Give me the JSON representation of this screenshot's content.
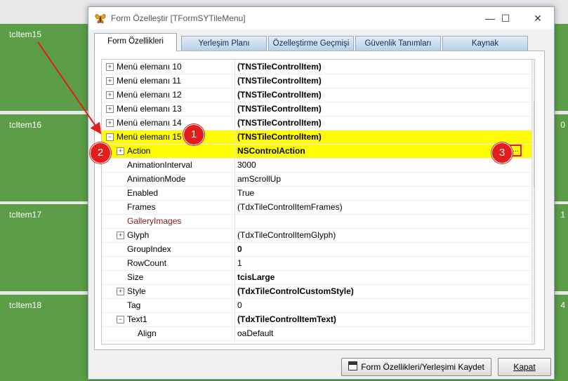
{
  "tiles": [
    {
      "label": "tcItem15",
      "right": ""
    },
    {
      "label": "tcItem16",
      "right": "0"
    },
    {
      "label": "tcItem17",
      "right": "1"
    },
    {
      "label": "tcItem18",
      "right": "4"
    }
  ],
  "window": {
    "title": "Form Özelleştir [TFormSYTileMenu]",
    "minimize": "—",
    "maximize": "☐",
    "close": "✕"
  },
  "tabs": [
    {
      "label": "Form Özellikleri",
      "active": true
    },
    {
      "label": "Yerleşim Planı",
      "active": false
    },
    {
      "label": "Özelleştirme Geçmişi",
      "active": false
    },
    {
      "label": "Güvenlik Tanımları",
      "active": false
    },
    {
      "label": "Kaynak",
      "active": false
    }
  ],
  "properties": [
    {
      "name": "Menü elemanı 10",
      "value": "(TNSTileControlItem)",
      "indent": 0,
      "expander": "+",
      "bold": true
    },
    {
      "name": "Menü elemanı 11",
      "value": "(TNSTileControlItem)",
      "indent": 0,
      "expander": "+",
      "bold": true
    },
    {
      "name": "Menü elemanı 12",
      "value": "(TNSTileControlItem)",
      "indent": 0,
      "expander": "+",
      "bold": true
    },
    {
      "name": "Menü elemanı 13",
      "value": "(TNSTileControlItem)",
      "indent": 0,
      "expander": "+",
      "bold": true
    },
    {
      "name": "Menü elemanı 14",
      "value": "(TNSTileControlItem)",
      "indent": 0,
      "expander": "+",
      "bold": true
    },
    {
      "name": "Menü elemanı 15",
      "value": "(TNSTileControlItem)",
      "indent": 0,
      "expander": "−",
      "bold": true,
      "highlight": true
    },
    {
      "name": "Action",
      "value": "NSControlAction",
      "indent": 1,
      "expander": "+",
      "bold": true,
      "highlight": true,
      "ellipsis": true
    },
    {
      "name": "AnimationInterval",
      "value": "3000",
      "indent": 1
    },
    {
      "name": "AnimationMode",
      "value": "amScrollUp",
      "indent": 1
    },
    {
      "name": "Enabled",
      "value": "True",
      "indent": 1
    },
    {
      "name": "Frames",
      "value": "(TdxTileControlItemFrames)",
      "indent": 1
    },
    {
      "name": "GalleryImages",
      "value": "",
      "indent": 1,
      "maroon": true
    },
    {
      "name": "Glyph",
      "value": "(TdxTileControlItemGlyph)",
      "indent": 1,
      "expander": "+"
    },
    {
      "name": "GroupIndex",
      "value": "0",
      "indent": 1,
      "bold": true
    },
    {
      "name": "RowCount",
      "value": "1",
      "indent": 1
    },
    {
      "name": "Size",
      "value": "tcisLarge",
      "indent": 1,
      "bold": true
    },
    {
      "name": "Style",
      "value": "(TdxTileControlCustomStyle)",
      "indent": 1,
      "expander": "+",
      "bold": true
    },
    {
      "name": "Tag",
      "value": "0",
      "indent": 1
    },
    {
      "name": "Text1",
      "value": "(TdxTileControlItemText)",
      "indent": 1,
      "expander": "−",
      "bold": true
    },
    {
      "name": "Align",
      "value": "oaDefault",
      "indent": 2
    }
  ],
  "ellipsis_label": "···",
  "buttons": {
    "save": "Form Özellikleri/Yerleşimi Kaydet",
    "close": "Kapat"
  },
  "badges": [
    "1",
    "2",
    "3"
  ],
  "colors": {
    "tile": "#5c9e47",
    "highlight": "#fffb00",
    "annotation": "#e51c1c"
  }
}
